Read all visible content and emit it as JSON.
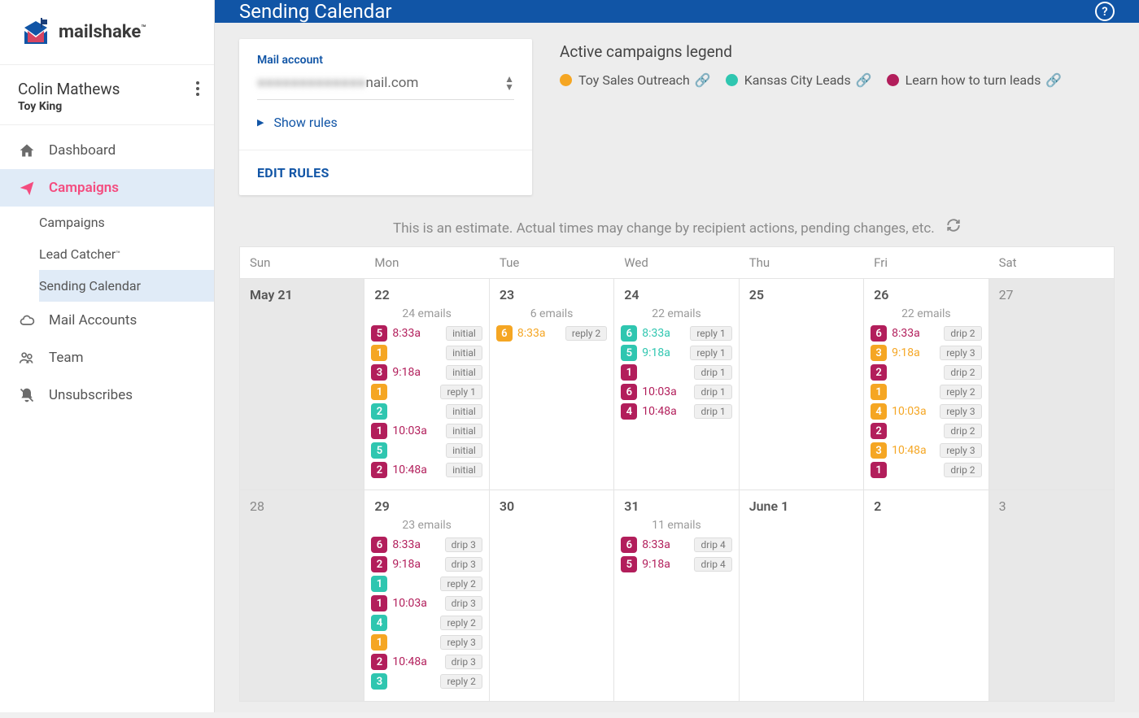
{
  "brand": {
    "name": "mailshake",
    "tm": "™"
  },
  "user": {
    "name": "Colin Mathews",
    "team": "Toy King"
  },
  "nav": {
    "dashboard": "Dashboard",
    "campaigns": "Campaigns",
    "sub_campaigns": "Campaigns",
    "sub_lead": "Lead Catcher",
    "sub_cal": "Sending Calendar",
    "mail_accounts": "Mail Accounts",
    "team": "Team",
    "unsubscribes": "Unsubscribes"
  },
  "header": {
    "title": "Sending Calendar"
  },
  "acct": {
    "label": "Mail account",
    "email_hidden": "●●●●●●●●●●●●●",
    "email_suffix": "nail.com",
    "show_rules": "Show rules",
    "edit_rules": "EDIT RULES"
  },
  "legend": {
    "title": "Active campaigns legend",
    "a": "Toy Sales Outreach",
    "b": "Kansas City Leads",
    "c": "Learn how to turn leads"
  },
  "note": "This is an estimate. Actual times may change by recipient actions, pending changes, etc.",
  "dow": [
    "Sun",
    "Mon",
    "Tue",
    "Wed",
    "Thu",
    "Fri",
    "Sat"
  ],
  "dates": {
    "w1": [
      "May  21",
      "22",
      "23",
      "24",
      "25",
      "26",
      "27"
    ],
    "w2": [
      "28",
      "29",
      "30",
      "31",
      "June  1",
      "2",
      "3"
    ]
  },
  "counts": {
    "d22": "24 emails",
    "d23": "6 emails",
    "d24": "22 emails",
    "d26": "22 emails",
    "d29": "23 emails",
    "d31": "11 emails"
  },
  "ev": {
    "d22": [
      {
        "c": "m",
        "n": "5",
        "t": "8:33a",
        "tag": "initial"
      },
      {
        "c": "o",
        "n": "1",
        "t": "",
        "tag": "initial"
      },
      {
        "c": "m",
        "n": "3",
        "t": "9:18a",
        "tag": "initial"
      },
      {
        "c": "o",
        "n": "1",
        "t": "",
        "tag": "reply 1"
      },
      {
        "c": "t",
        "n": "2",
        "t": "",
        "tag": "initial"
      },
      {
        "c": "m",
        "n": "1",
        "t": "10:03a",
        "tag": "initial"
      },
      {
        "c": "t",
        "n": "5",
        "t": "",
        "tag": "initial"
      },
      {
        "c": "m",
        "n": "2",
        "t": "10:48a",
        "tag": "initial"
      }
    ],
    "d23": [
      {
        "c": "o",
        "n": "6",
        "t": "8:33a",
        "tag": "reply 2"
      }
    ],
    "d24": [
      {
        "c": "t",
        "n": "6",
        "t": "8:33a",
        "tag": "reply 1"
      },
      {
        "c": "t",
        "n": "5",
        "t": "9:18a",
        "tag": "reply 1"
      },
      {
        "c": "m",
        "n": "1",
        "t": "",
        "tag": "drip 1"
      },
      {
        "c": "m",
        "n": "6",
        "t": "10:03a",
        "tag": "drip 1"
      },
      {
        "c": "m",
        "n": "4",
        "t": "10:48a",
        "tag": "drip 1"
      }
    ],
    "d26": [
      {
        "c": "m",
        "n": "6",
        "t": "8:33a",
        "tag": "drip 2"
      },
      {
        "c": "o",
        "n": "3",
        "t": "9:18a",
        "tag": "reply 3"
      },
      {
        "c": "m",
        "n": "2",
        "t": "",
        "tag": "drip 2"
      },
      {
        "c": "o",
        "n": "1",
        "t": "",
        "tag": "reply 2"
      },
      {
        "c": "o",
        "n": "4",
        "t": "10:03a",
        "tag": "reply 3"
      },
      {
        "c": "m",
        "n": "2",
        "t": "",
        "tag": "drip 2"
      },
      {
        "c": "o",
        "n": "3",
        "t": "10:48a",
        "tag": "reply 3"
      },
      {
        "c": "m",
        "n": "1",
        "t": "",
        "tag": "drip 2"
      }
    ],
    "d29": [
      {
        "c": "m",
        "n": "6",
        "t": "8:33a",
        "tag": "drip 3"
      },
      {
        "c": "m",
        "n": "2",
        "t": "9:18a",
        "tag": "drip 3"
      },
      {
        "c": "t",
        "n": "1",
        "t": "",
        "tag": "reply 2"
      },
      {
        "c": "m",
        "n": "1",
        "t": "10:03a",
        "tag": "drip 3"
      },
      {
        "c": "t",
        "n": "4",
        "t": "",
        "tag": "reply 2"
      },
      {
        "c": "o",
        "n": "1",
        "t": "",
        "tag": "reply 3"
      },
      {
        "c": "m",
        "n": "2",
        "t": "10:48a",
        "tag": "drip 3"
      },
      {
        "c": "t",
        "n": "3",
        "t": "",
        "tag": "reply 2"
      }
    ],
    "d31": [
      {
        "c": "m",
        "n": "6",
        "t": "8:33a",
        "tag": "drip 4"
      },
      {
        "c": "m",
        "n": "5",
        "t": "9:18a",
        "tag": "drip 4"
      }
    ]
  }
}
